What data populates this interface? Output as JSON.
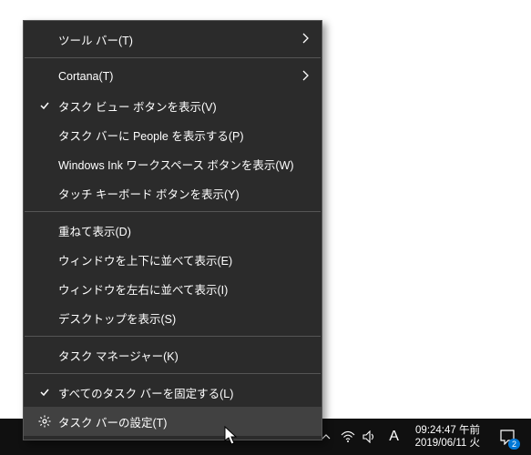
{
  "menu": {
    "toolbars": "ツール バー(T)",
    "cortana": "Cortana(T)",
    "taskview_btn": "タスク ビュー ボタンを表示(V)",
    "people_btn": "タスク バーに People を表示する(P)",
    "ink_btn": "Windows Ink ワークスペース ボタンを表示(W)",
    "touch_kbd": "タッチ キーボード ボタンを表示(Y)",
    "cascade": "重ねて表示(D)",
    "stack": "ウィンドウを上下に並べて表示(E)",
    "sidebyside": "ウィンドウを左右に並べて表示(I)",
    "show_desktop": "デスクトップを表示(S)",
    "task_manager": "タスク マネージャー(K)",
    "lock_all": "すべてのタスク バーを固定する(L)",
    "settings": "タスク バーの設定(T)"
  },
  "tray": {
    "ime": "A",
    "time": "09:24:47 午前",
    "date": "2019/06/11 火",
    "badge": "2"
  }
}
